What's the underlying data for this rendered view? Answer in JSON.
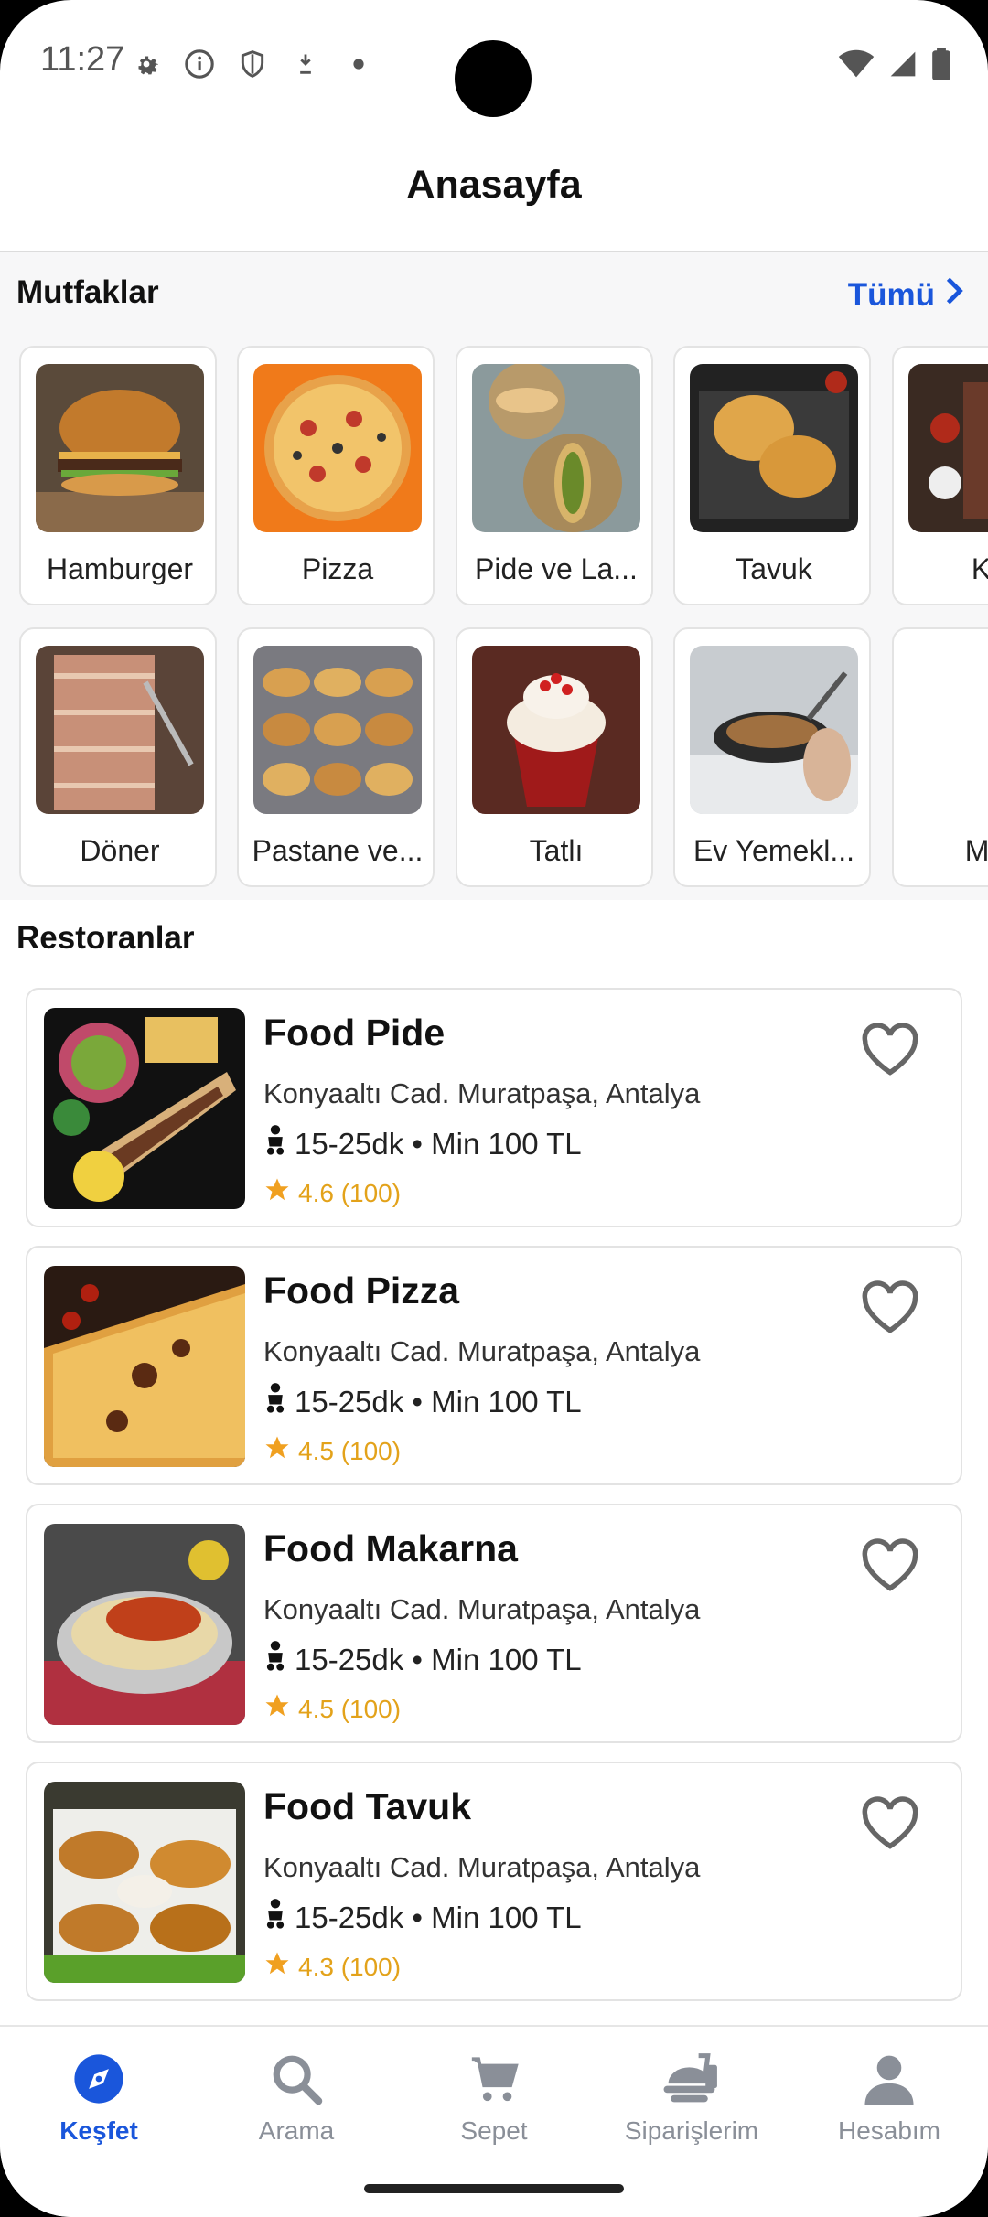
{
  "status_bar": {
    "time": "11:27",
    "left_icons": [
      "gear-icon",
      "info-icon",
      "shield-icon",
      "download-icon",
      "dot-icon"
    ],
    "right_icons": [
      "wifi-icon",
      "signal-icon",
      "battery-icon"
    ]
  },
  "header": {
    "title": "Anasayfa"
  },
  "cuisines": {
    "title": "Mutfaklar",
    "see_all": "Tümü",
    "items": [
      {
        "label": "Hamburger"
      },
      {
        "label": "Pizza"
      },
      {
        "label": "Pide ve La..."
      },
      {
        "label": "Tavuk"
      },
      {
        "label": "Kel"
      },
      {
        "label": "Döner"
      },
      {
        "label": "Pastane ve..."
      },
      {
        "label": "Tatlı"
      },
      {
        "label": "Ev Yemekl..."
      },
      {
        "label": "Mak"
      }
    ]
  },
  "restaurants": {
    "title": "Restoranlar",
    "items": [
      {
        "name": "Food Pide",
        "address": "Konyaaltı Cad. Muratpaşa, Antalya",
        "delivery": "15-25dk • Min 100 TL",
        "rating": "4.6 (100)"
      },
      {
        "name": "Food Pizza",
        "address": "Konyaaltı Cad. Muratpaşa, Antalya",
        "delivery": "15-25dk • Min 100 TL",
        "rating": "4.5 (100)"
      },
      {
        "name": "Food Makarna",
        "address": "Konyaaltı Cad. Muratpaşa, Antalya",
        "delivery": "15-25dk • Min 100 TL",
        "rating": "4.5 (100)"
      },
      {
        "name": "Food Tavuk",
        "address": "Konyaaltı Cad. Muratpaşa, Antalya",
        "delivery": "15-25dk • Min 100 TL",
        "rating": "4.3 (100)"
      }
    ]
  },
  "bottom_nav": {
    "items": [
      {
        "label": "Keşfet",
        "icon": "compass-icon",
        "active": true
      },
      {
        "label": "Arama",
        "icon": "search-icon",
        "active": false
      },
      {
        "label": "Sepet",
        "icon": "cart-icon",
        "active": false
      },
      {
        "label": "Siparişlerim",
        "icon": "orders-icon",
        "active": false
      },
      {
        "label": "Hesabım",
        "icon": "account-icon",
        "active": false
      }
    ]
  },
  "colors": {
    "accent": "#1a56db",
    "rating": "#e3a21a",
    "inactive": "#8a8f98"
  }
}
